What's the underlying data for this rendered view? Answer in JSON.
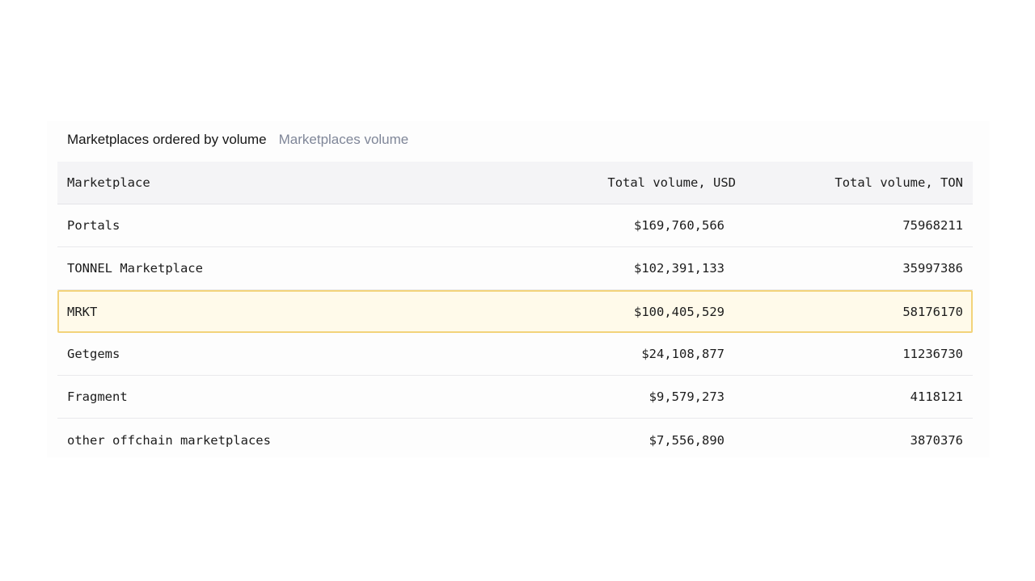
{
  "tabs": [
    {
      "label": "Marketplaces ordered by volume",
      "active": true
    },
    {
      "label": "Marketplaces volume",
      "active": false
    }
  ],
  "table": {
    "columns": [
      "Marketplace",
      "Total volume, USD",
      "Total volume, TON"
    ],
    "rows": [
      {
        "name": "Portals",
        "usd": "$169,760,566",
        "ton": "75968211",
        "highlighted": false
      },
      {
        "name": "TONNEL Marketplace",
        "usd": "$102,391,133",
        "ton": "35997386",
        "highlighted": false
      },
      {
        "name": "MRKT",
        "usd": "$100,405,529",
        "ton": "58176170",
        "highlighted": true
      },
      {
        "name": "Getgems",
        "usd": "$24,108,877",
        "ton": "11236730",
        "highlighted": false
      },
      {
        "name": "Fragment",
        "usd": "$9,579,273",
        "ton": "4118121",
        "highlighted": false
      },
      {
        "name": "other offchain marketplaces",
        "usd": "$7,556,890",
        "ton": "3870376",
        "highlighted": false
      }
    ]
  },
  "colors": {
    "highlight_fill": "#fffaea",
    "highlight_border": "#f3d37a",
    "header_bg": "#f4f4f6",
    "inactive_tab": "#7f8698"
  }
}
